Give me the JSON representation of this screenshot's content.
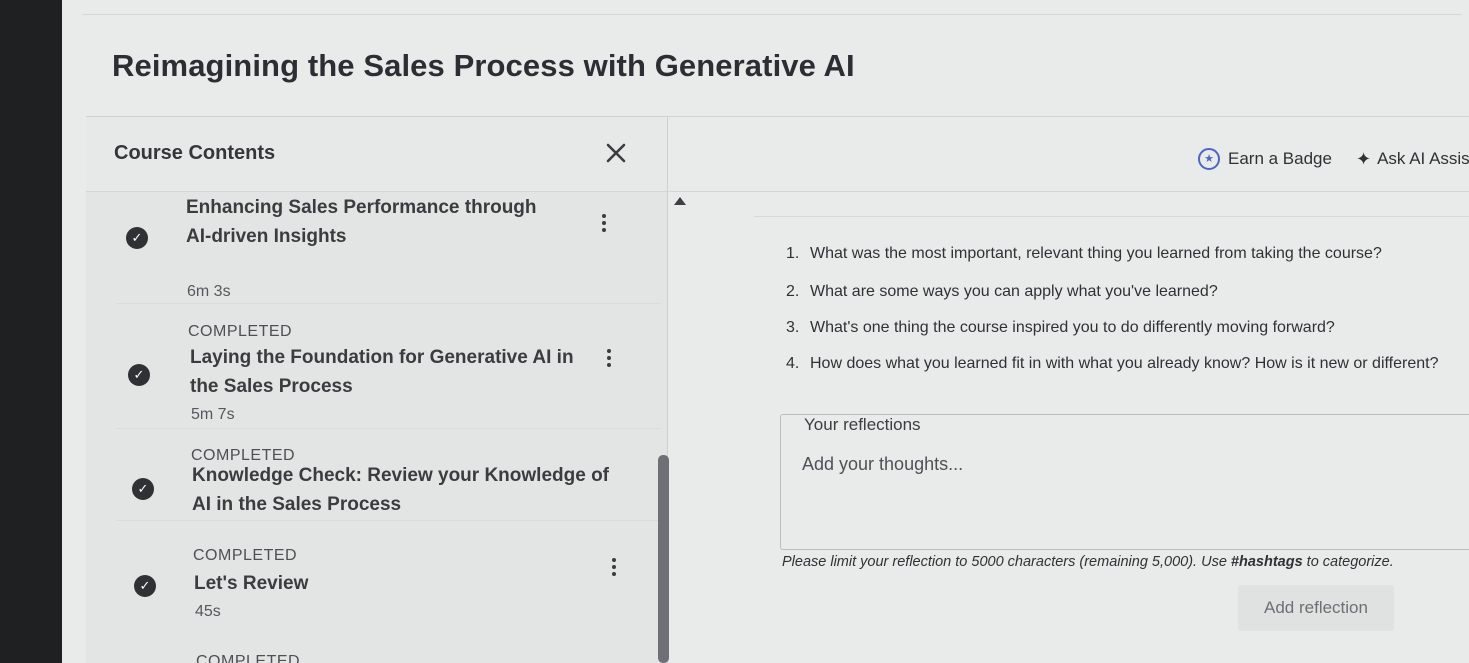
{
  "course": {
    "title": "Reimagining the Sales Process with Generative AI"
  },
  "sidebar": {
    "title": "Course Contents",
    "items": [
      {
        "title": "Enhancing Sales Performance through AI-driven Insights",
        "duration": "6m 3s",
        "status": "COMPLETED"
      },
      {
        "title": "Laying the Foundation for Generative AI in the Sales Process",
        "duration": "5m 7s",
        "status": "COMPLETED"
      },
      {
        "title": "Knowledge Check: Review your Knowledge of AI in the Sales Process",
        "duration": "",
        "status": "COMPLETED"
      },
      {
        "title": "Let's Review",
        "duration": "45s",
        "status": "COMPLETED"
      }
    ]
  },
  "toolbar": {
    "badge_label": "Earn a Badge",
    "ai_label": "Ask AI Assist"
  },
  "questions": [
    {
      "num": "1.",
      "text": "What was the most important, relevant thing you learned from taking the course?"
    },
    {
      "num": "2.",
      "text": "What are some ways you can apply what you've learned?"
    },
    {
      "num": "3.",
      "text": "What's one thing the course inspired you to do differently moving forward?"
    },
    {
      "num": "4.",
      "text": "How does what you learned fit in with what you already know? How is it new or different?"
    }
  ],
  "reflection": {
    "label": "Your reflections",
    "placeholder": "Add your thoughts...",
    "hint_prefix": "Please limit your reflection to 5000 characters (remaining 5,000). Use ",
    "hint_tag": "#hashtags",
    "hint_suffix": " to categorize.",
    "button_label": "Add reflection"
  },
  "colors": {
    "badge_accent": "#4a67c4",
    "check_fill": "#2f3135"
  },
  "icons": [
    "close-icon",
    "check-icon",
    "more-vertical-icon",
    "badge-star-icon",
    "sparkle-icon",
    "caret-up-icon"
  ]
}
